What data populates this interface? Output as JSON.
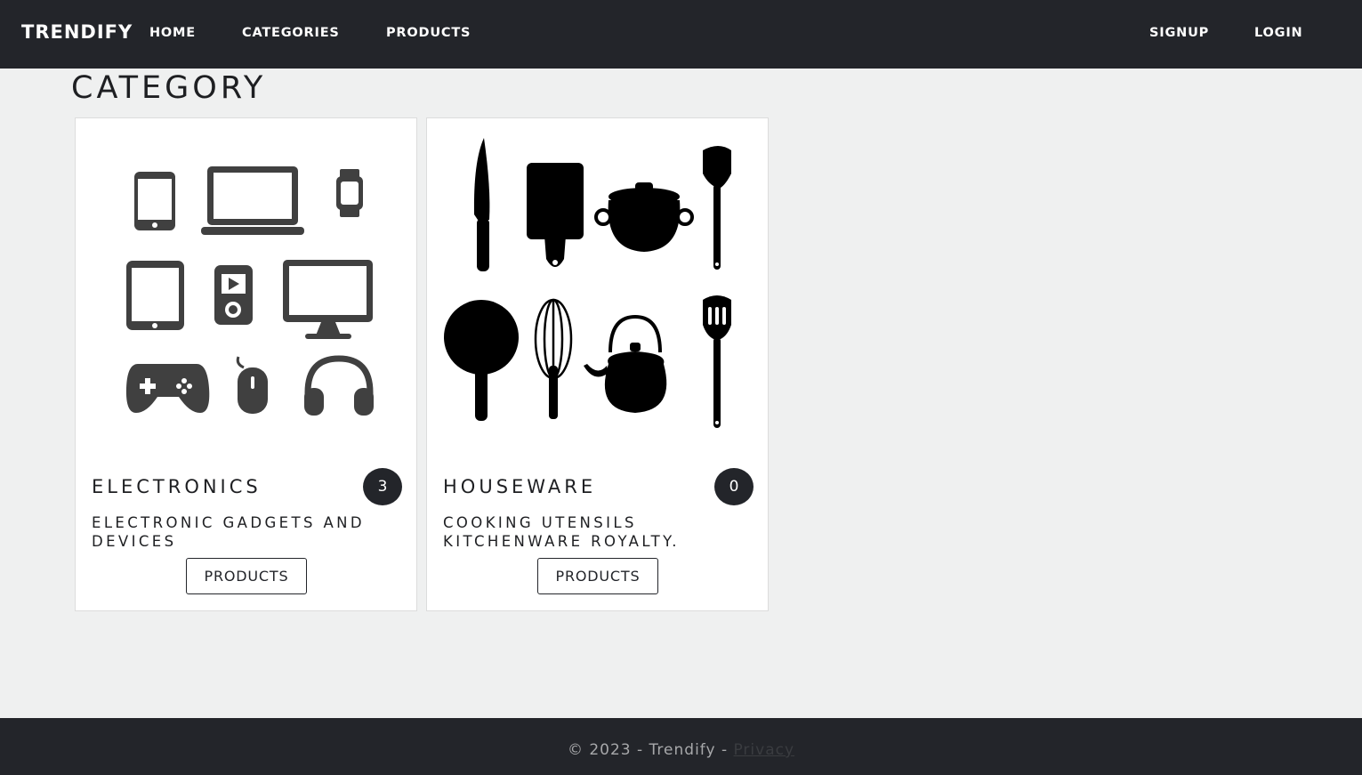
{
  "navbar": {
    "brand": "TRENDIFY",
    "links": [
      "HOME",
      "CATEGORIES",
      "PRODUCTS"
    ],
    "right_links": [
      "SIGNUP",
      "LOGIN"
    ]
  },
  "page": {
    "title": "CATEGORY"
  },
  "categories": [
    {
      "name": "ELECTRONICS",
      "count": "3",
      "description": "ELECTRONIC GADGETS AND DEVICES",
      "button_label": "PRODUCTS",
      "image": "electronics-devices-icon-grid"
    },
    {
      "name": "HOUSEWARE",
      "count": "0",
      "description": "COOKING UTENSILS KITCHENWARE ROYALTY.",
      "button_label": "PRODUCTS",
      "image": "kitchen-utensils-icon-grid"
    }
  ],
  "footer": {
    "text": "© 2023 - Trendify - ",
    "privacy_label": "Privacy"
  },
  "colors": {
    "navbar_bg": "#23252a",
    "page_bg": "#eff0f0",
    "badge_bg": "#23252a",
    "electronics_icon": "#404040",
    "houseware_icon": "#000000"
  }
}
